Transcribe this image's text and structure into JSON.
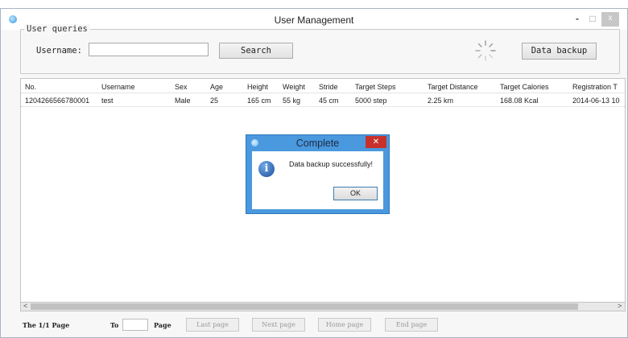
{
  "window": {
    "title": "User Management",
    "minimize": "-",
    "maximize": "□",
    "close": "x"
  },
  "query": {
    "group_label": "User queries",
    "username_label": "Username:",
    "username_value": "",
    "search_label": "Search",
    "backup_label": "Data backup"
  },
  "table": {
    "columns": [
      "No.",
      "Username",
      "Sex",
      "Age",
      "Height",
      "Weight",
      "Stride",
      "Target Steps",
      "Target Distance",
      "Target Calories",
      "Registration T"
    ],
    "rows": [
      [
        "1204266566780001",
        "test",
        "Male",
        "25",
        "165 cm",
        "55 kg",
        "45 cm",
        "5000 step",
        "2.25 km",
        "168.08 Kcal",
        "2014-06-13 10"
      ]
    ]
  },
  "scrollbar": {
    "left_arrow": "<",
    "right_arrow": ">"
  },
  "footer": {
    "page_info": "The 1/1 Page",
    "to_label": "To",
    "page_value": "",
    "page_label": "Page",
    "last_page": "Last page",
    "next_page": "Next page",
    "home_page": "Home page",
    "end_page": "End page"
  },
  "dialog": {
    "title": "Complete",
    "close": "✕",
    "icon_glyph": "i",
    "message": "Data backup successfully!",
    "ok_label": "OK"
  }
}
